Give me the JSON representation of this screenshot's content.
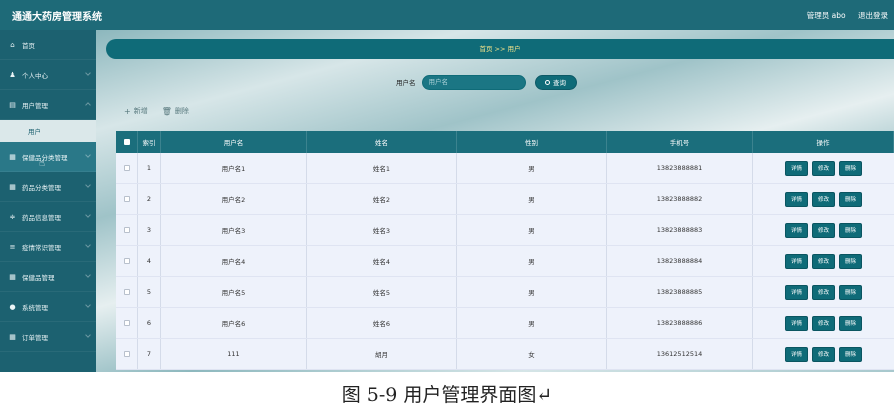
{
  "header": {
    "title": "通通大药房管理系统",
    "admin": "管理员 abo",
    "logout": "退出登录"
  },
  "sidebar": {
    "items": [
      {
        "label": "首页",
        "icon": "home-icon",
        "glyph": "⌂"
      },
      {
        "label": "个人中心",
        "icon": "person-icon",
        "glyph": "♟"
      },
      {
        "label": "用户管理",
        "icon": "folder-icon",
        "glyph": "▤"
      },
      {
        "label": "保健品分类管理",
        "icon": "grid-icon",
        "glyph": "▦"
      },
      {
        "label": "药品分类管理",
        "icon": "grid-icon",
        "glyph": "▦"
      },
      {
        "label": "药品信息管理",
        "icon": "filter-icon",
        "glyph": "≑"
      },
      {
        "label": "疫情常识管理",
        "icon": "list-icon",
        "glyph": "≡"
      },
      {
        "label": "保健品管理",
        "icon": "grid-icon",
        "glyph": "▦"
      },
      {
        "label": "系统管理",
        "icon": "pin-icon",
        "glyph": "●"
      },
      {
        "label": "订单管理",
        "icon": "grid-icon",
        "glyph": "▦"
      }
    ],
    "sub_user": "用户"
  },
  "breadcrumb": {
    "text": "首页 >> 用户"
  },
  "search": {
    "label": "用户名",
    "placeholder": "用户名",
    "button": "查询"
  },
  "actions": {
    "add": "新增",
    "delete": "删除"
  },
  "table": {
    "headers": {
      "index": "索引",
      "username": "用户名",
      "name": "姓名",
      "gender": "性别",
      "phone": "手机号",
      "ops": "操作"
    },
    "op_labels": {
      "detail": "详情",
      "edit": "修改",
      "delete": "删除"
    },
    "rows": [
      {
        "index": "1",
        "username": "用户名1",
        "name": "姓名1",
        "gender": "男",
        "phone": "13823888881"
      },
      {
        "index": "2",
        "username": "用户名2",
        "name": "姓名2",
        "gender": "男",
        "phone": "13823888882"
      },
      {
        "index": "3",
        "username": "用户名3",
        "name": "姓名3",
        "gender": "男",
        "phone": "13823888883"
      },
      {
        "index": "4",
        "username": "用户名4",
        "name": "姓名4",
        "gender": "男",
        "phone": "13823888884"
      },
      {
        "index": "5",
        "username": "用户名5",
        "name": "姓名5",
        "gender": "男",
        "phone": "13823888885"
      },
      {
        "index": "6",
        "username": "用户名6",
        "name": "姓名6",
        "gender": "男",
        "phone": "13823888886"
      },
      {
        "index": "7",
        "username": "111",
        "name": "胡月",
        "gender": "女",
        "phone": "13612512514"
      }
    ]
  },
  "caption": "图 5-9 用户管理界面图↵"
}
